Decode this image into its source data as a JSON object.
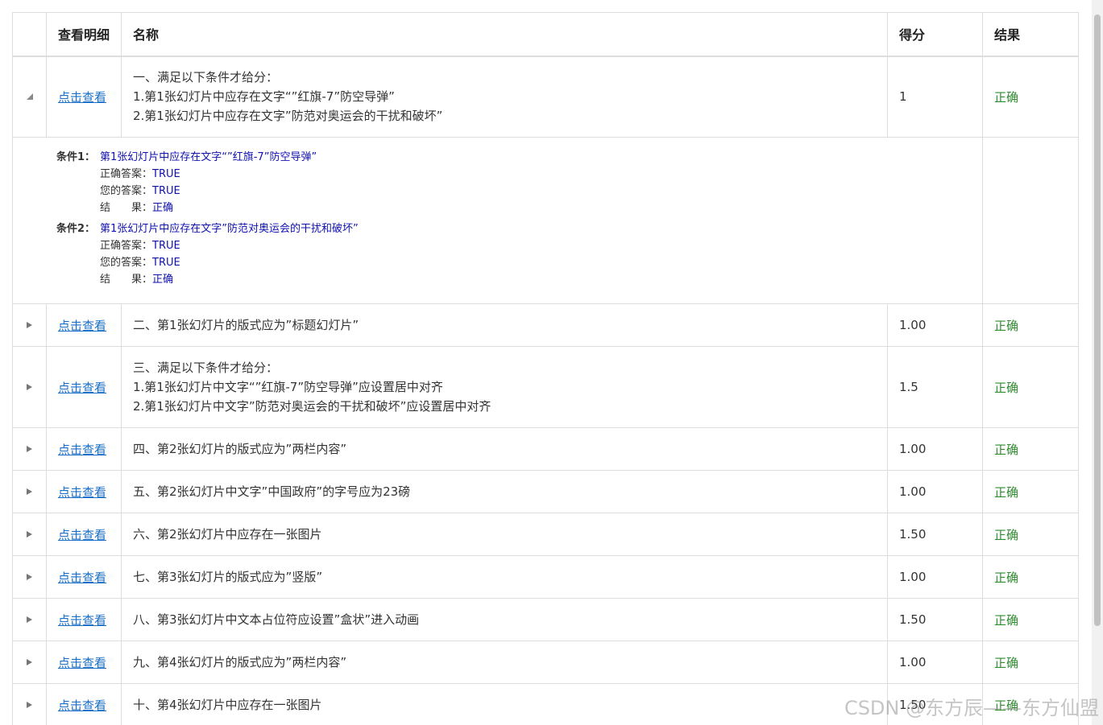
{
  "table": {
    "headers": [
      "",
      "查看明细",
      "名称",
      "得分",
      "结果"
    ],
    "rows": [
      {
        "detail_label": "点击查看",
        "name_lines": [
          "一、满足以下条件才给分：",
          "1.第1张幻灯片中应存在文字“”红旗-7”防空导弹”",
          "2.第1张幻灯片中应存在文字”防范对奥运会的干扰和破坏”"
        ],
        "score": "1",
        "result": "正确",
        "expanded": true
      },
      {
        "detail_label": "点击查看",
        "name_lines": [
          "二、第1张幻灯片的版式应为”标题幻灯片”"
        ],
        "score": "1.00",
        "result": "正确"
      },
      {
        "detail_label": "点击查看",
        "name_lines": [
          "三、满足以下条件才给分：",
          "1.第1张幻灯片中文字“”红旗-7”防空导弹”应设置居中对齐",
          "2.第1张幻灯片中文字”防范对奥运会的干扰和破坏”应设置居中对齐"
        ],
        "score": "1.5",
        "result": "正确"
      },
      {
        "detail_label": "点击查看",
        "name_lines": [
          "四、第2张幻灯片的版式应为”两栏内容”"
        ],
        "score": "1.00",
        "result": "正确"
      },
      {
        "detail_label": "点击查看",
        "name_lines": [
          "五、第2张幻灯片中文字”中国政府”的字号应为23磅"
        ],
        "score": "1.00",
        "result": "正确"
      },
      {
        "detail_label": "点击查看",
        "name_lines": [
          "六、第2张幻灯片中应存在一张图片"
        ],
        "score": "1.50",
        "result": "正确"
      },
      {
        "detail_label": "点击查看",
        "name_lines": [
          "七、第3张幻灯片的版式应为”竖版”"
        ],
        "score": "1.00",
        "result": "正确"
      },
      {
        "detail_label": "点击查看",
        "name_lines": [
          "八、第3张幻灯片中文本占位符应设置”盒状”进入动画"
        ],
        "score": "1.50",
        "result": "正确"
      },
      {
        "detail_label": "点击查看",
        "name_lines": [
          "九、第4张幻灯片的版式应为”两栏内容”"
        ],
        "score": "1.00",
        "result": "正确"
      },
      {
        "detail_label": "点击查看",
        "name_lines": [
          "十、第4张幻灯片中应存在一张图片"
        ],
        "score": "1.50",
        "result": "正确"
      }
    ]
  },
  "detail": {
    "conditions": [
      {
        "label": "条件1：",
        "title": "第1张幻灯片中应存在文字“”红旗-7”防空导弹”",
        "correct_label": "正确答案：",
        "correct_value": "TRUE",
        "yours_label": "您的答案：",
        "yours_value": "TRUE",
        "result_label": "结　　果：",
        "result_value": "正确"
      },
      {
        "label": "条件2：",
        "title": "第1张幻灯片中应存在文字”防范对奥运会的干扰和破坏”",
        "correct_label": "正确答案：",
        "correct_value": "TRUE",
        "yours_label": "您的答案：",
        "yours_value": "TRUE",
        "result_label": "结　　果：",
        "result_value": "正确"
      }
    ]
  },
  "watermark": "CSDN @东方辰——东方仙盟"
}
